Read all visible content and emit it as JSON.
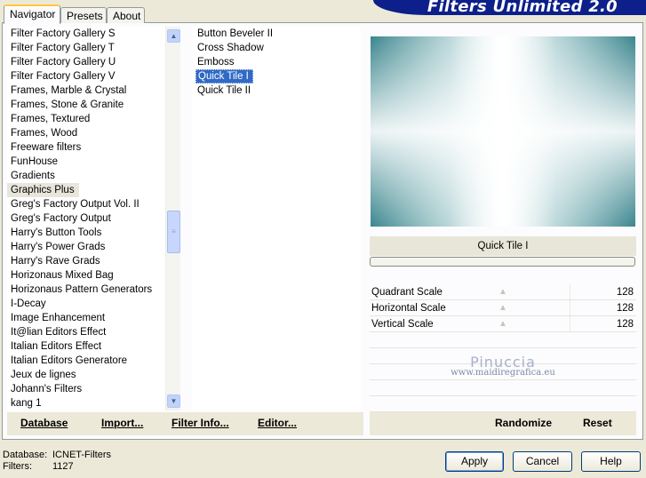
{
  "header": {
    "title": "Filters Unlimited 2.0"
  },
  "tabs": [
    {
      "label": "Navigator",
      "active": true
    },
    {
      "label": "Presets",
      "active": false
    },
    {
      "label": "About",
      "active": false
    }
  ],
  "categories": [
    "Filter Factory Gallery S",
    "Filter Factory Gallery T",
    "Filter Factory Gallery U",
    "Filter Factory Gallery V",
    "Frames, Marble & Crystal",
    "Frames, Stone & Granite",
    "Frames, Textured",
    "Frames, Wood",
    "Freeware filters",
    "FunHouse",
    "Gradients",
    "Graphics Plus",
    "Greg's Factory Output Vol. II",
    "Greg's Factory Output",
    "Harry's Button Tools",
    "Harry's Power Grads",
    "Harry's Rave Grads",
    "Horizonaus Mixed Bag",
    "Horizonaus Pattern Generators",
    "I-Decay",
    "Image Enhancement",
    "It@lian Editors Effect",
    "Italian Editors Effect",
    "Italian Editors Generatore",
    "Jeux de lignes",
    "Johann's Filters",
    "kang 1"
  ],
  "selected_category": "Graphics Plus",
  "filters": [
    "Button Beveler II",
    "Cross Shadow",
    "Emboss",
    "Quick Tile I",
    "Quick Tile II"
  ],
  "selected_filter": "Quick Tile I",
  "preview": {
    "filter_name": "Quick Tile I",
    "colors": {
      "teal": "#3f8c93",
      "light": "#ffffff"
    }
  },
  "controls": [
    {
      "label": "Quadrant Scale",
      "value": "128"
    },
    {
      "label": "Horizontal Scale",
      "value": "128"
    },
    {
      "label": "Vertical Scale",
      "value": "128"
    }
  ],
  "watermark": {
    "name": "Pinuccia",
    "url": "www.maidiregrafica.eu"
  },
  "left_buttons": {
    "database": "Database",
    "import": "Import...",
    "filter_info": "Filter Info...",
    "editor": "Editor..."
  },
  "right_buttons": {
    "randomize": "Randomize",
    "reset": "Reset"
  },
  "status": {
    "database_label": "Database:",
    "database_value": "ICNET-Filters",
    "filters_label": "Filters:",
    "filters_value": "1127"
  },
  "dialog_buttons": {
    "apply": "Apply",
    "cancel": "Cancel",
    "help": "Help"
  },
  "accent_colors": {
    "selection": "#316ac5",
    "banner": "#0c1f8a",
    "tab_highlight": "#ffc83c"
  }
}
